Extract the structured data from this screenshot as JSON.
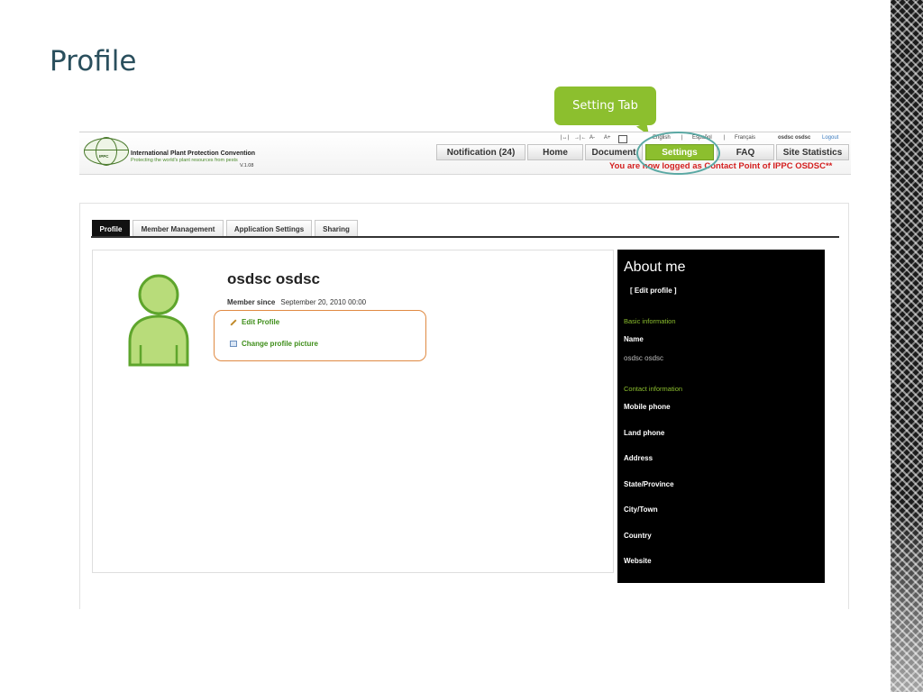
{
  "slide": {
    "title": "Profile"
  },
  "callout": {
    "label": "Setting Tab"
  },
  "site": {
    "org_name": "International Plant Protection Convention",
    "tagline": "Protecting the world's plant resources from pests",
    "version": "V.1.08",
    "logo_text": "IPPC",
    "nav": [
      "Notification (24)",
      "Home",
      "Document",
      "Settings",
      "FAQ",
      "Site Statistics"
    ],
    "active_nav": "Settings",
    "font_sizes": {
      "decrease": "A-",
      "increase": "A+"
    },
    "languages": [
      "English",
      "|",
      "Español",
      "|",
      "Français"
    ],
    "username": "osdsc osdsc",
    "logout": "Logout",
    "logged_msg": "You are now logged as Contact Point of IPPC OSDSC**"
  },
  "profile_tabs": [
    "Profile",
    "Member Management",
    "Application Settings",
    "Sharing"
  ],
  "user": {
    "name": "osdsc osdsc",
    "member_since_label": "Member since",
    "member_since_value": "September 20, 2010  00:00",
    "edit_profile": "Edit Profile",
    "change_picture": "Change profile picture"
  },
  "about": {
    "title": "About me",
    "edit": "[ Edit profile ]",
    "basic_heading": "Basic information",
    "name_label": "Name",
    "name_value": "osdsc osdsc",
    "contact_heading": "Contact information",
    "mobile": "Mobile phone",
    "land": "Land phone",
    "address": "Address",
    "state": "State/Province",
    "city": "City/Town",
    "country": "Country",
    "website": "Website"
  },
  "colors": {
    "accent": "#8cbf2e",
    "warning": "#d42020",
    "highlight": "#e08a42",
    "callout_ring": "#5aa9a4"
  }
}
